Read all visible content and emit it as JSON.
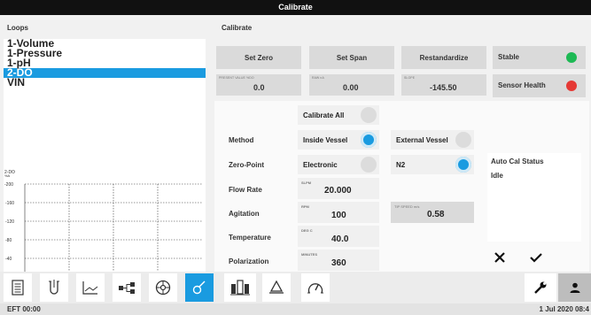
{
  "window": {
    "title": "Calibrate"
  },
  "loops": {
    "header": "Loops",
    "items": [
      {
        "label": "1-Volume",
        "selected": false
      },
      {
        "label": "1-Pressure",
        "selected": false
      },
      {
        "label": "1-pH",
        "selected": false
      },
      {
        "label": "2-DO",
        "selected": true
      },
      {
        "label": "VIN",
        "selected": false
      }
    ]
  },
  "chart": {
    "series_label": "2-DO",
    "unit": "%A",
    "y_ticks": [
      "200",
      "160",
      "120",
      "80",
      "40",
      "0"
    ],
    "x_ticks": [
      "1 Jul 08:27",
      "1 Jul 08:42"
    ]
  },
  "chart_data": {
    "type": "line",
    "series": [
      {
        "name": "2-DO",
        "x": [
          "1 Jul 08:27",
          "1 Jul 08:42"
        ],
        "values": [
          0,
          0
        ]
      }
    ],
    "ylabel": "%A",
    "ylim": [
      0,
      200
    ],
    "grid": true
  },
  "calibrate": {
    "header": "Calibrate",
    "set_zero": "Set Zero",
    "set_span": "Set Span",
    "restandardize": "Restandardize",
    "stable": {
      "label": "Stable",
      "color": "#1db954"
    },
    "sensor_health": {
      "label": "Sensor Health",
      "color": "#e53935"
    },
    "present_value": {
      "caption": "PRESENT VALUE %DO",
      "value": "0.0"
    },
    "raw": {
      "caption": "RAW nA",
      "value": "0.00"
    },
    "slope": {
      "caption": "SLOPE",
      "value": "-145.50"
    }
  },
  "form": {
    "calibrate_all": "Calibrate All",
    "method": {
      "label": "Method",
      "inside_vessel": "Inside Vessel",
      "external_vessel": "External Vessel"
    },
    "zero_point": {
      "label": "Zero-Point",
      "electronic": "Electronic",
      "n2": "N2"
    },
    "flow_rate": {
      "label": "Flow Rate",
      "unit": "SLPM",
      "value": "20.000"
    },
    "agitation": {
      "label": "Agitation",
      "unit": "RPM",
      "value": "100",
      "tip_caption": "TIP SPEED m/s",
      "tip_value": "0.58"
    },
    "temperature": {
      "label": "Temperature",
      "unit": "DEG C",
      "value": "40.0"
    },
    "polarization": {
      "label": "Polarization",
      "unit": "MINUTES",
      "value": "360"
    },
    "auto_cal": {
      "title": "Auto Cal Status",
      "value": "Idle"
    }
  },
  "toolbar": {
    "icons": [
      "document-icon",
      "vessel-icon",
      "trend-icon",
      "network-icon",
      "gauge-icon",
      "probe-icon",
      "dashboard-icon",
      "alarm-bell-icon",
      "meter-icon",
      "wrench-icon",
      "user-icon"
    ]
  },
  "statusbar": {
    "left": "EFT  00:00",
    "right": "1 Jul 2020  08:4"
  }
}
